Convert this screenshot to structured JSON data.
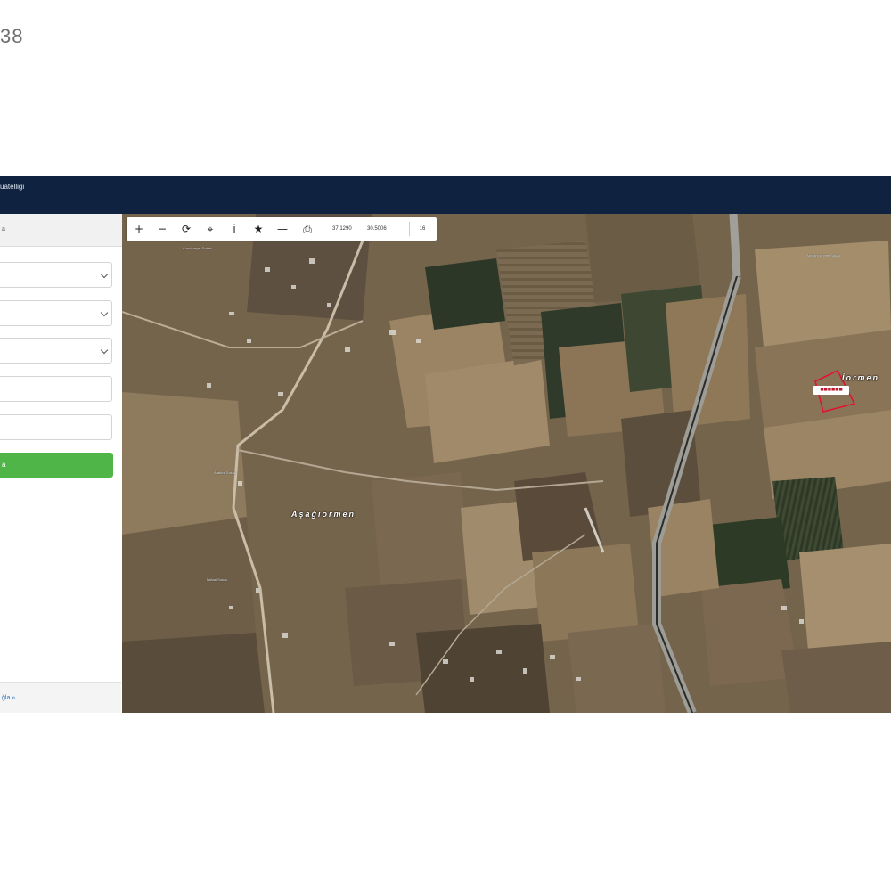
{
  "listing": {
    "number_partial": "38"
  },
  "header": {
    "app_title_partial": "uatelliği"
  },
  "sidebar": {
    "heading_partial": "a",
    "button_label_partial": "a",
    "footer_link_partial": "ğla »"
  },
  "toolbar": {
    "zoom_in_icon": "plus-icon",
    "zoom_out_icon": "minus-icon",
    "refresh_icon": "refresh-icon",
    "locate_icon": "crosshair-icon",
    "info_icon": "info-icon",
    "favorite_icon": "star-icon",
    "measure_icon": "line-icon",
    "print_icon": "printer-icon",
    "latitude": "37.1290",
    "longitude": "30.5006",
    "zoom_level": "16"
  },
  "map": {
    "village_label": "Aşağıormen",
    "village_label_2": "İormen",
    "parcel_tag": "■■■■■■",
    "road_labels": [
      "Cumhuriyet Sokak",
      "Bayram Ahmet Sokak",
      "Atatürk Sokak",
      "İstiklal Sokak"
    ],
    "colors": {
      "parcel_outline": "#e0142e",
      "header_bg": "#0f2340",
      "button_green": "#4fb548"
    }
  }
}
